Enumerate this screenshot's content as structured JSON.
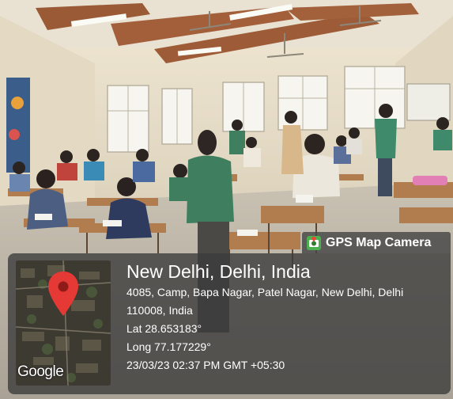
{
  "overlay": {
    "badge_label": "GPS Map Camera",
    "badge_icon": "camera-location-icon",
    "place_title": "New Delhi, Delhi, India",
    "address_line1": "4085, Camp, Bapa Nagar, Patel Nagar, New Delhi, Delhi",
    "address_line2": "110008, India",
    "latitude": "Lat 28.653183°",
    "longitude": "Long 77.177229°",
    "datetime": "23/03/23 02:37 PM GMT +05:30",
    "map_logo": "Google",
    "pin_color": "#e53935"
  },
  "colors": {
    "overlay_background": "#3c3c3c",
    "text": "#ffffff"
  }
}
